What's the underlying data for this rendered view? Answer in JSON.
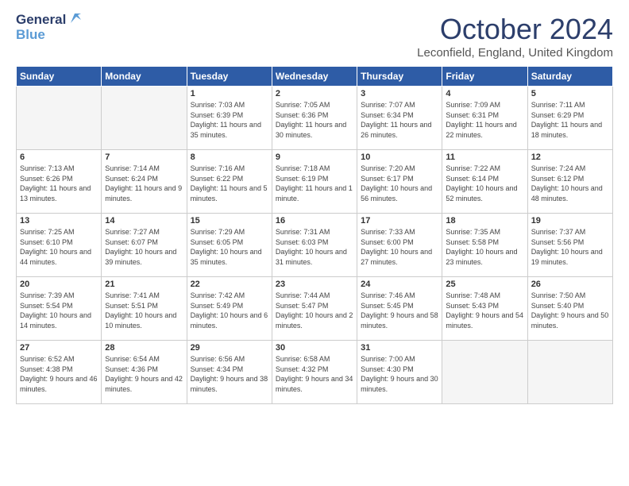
{
  "header": {
    "logo_general": "General",
    "logo_blue": "Blue",
    "month_title": "October 2024",
    "location": "Leconfield, England, United Kingdom"
  },
  "weekdays": [
    "Sunday",
    "Monday",
    "Tuesday",
    "Wednesday",
    "Thursday",
    "Friday",
    "Saturday"
  ],
  "weeks": [
    [
      {
        "day": "",
        "empty": true
      },
      {
        "day": "",
        "empty": true
      },
      {
        "day": "1",
        "sunrise": "Sunrise: 7:03 AM",
        "sunset": "Sunset: 6:39 PM",
        "daylight": "Daylight: 11 hours and 35 minutes."
      },
      {
        "day": "2",
        "sunrise": "Sunrise: 7:05 AM",
        "sunset": "Sunset: 6:36 PM",
        "daylight": "Daylight: 11 hours and 30 minutes."
      },
      {
        "day": "3",
        "sunrise": "Sunrise: 7:07 AM",
        "sunset": "Sunset: 6:34 PM",
        "daylight": "Daylight: 11 hours and 26 minutes."
      },
      {
        "day": "4",
        "sunrise": "Sunrise: 7:09 AM",
        "sunset": "Sunset: 6:31 PM",
        "daylight": "Daylight: 11 hours and 22 minutes."
      },
      {
        "day": "5",
        "sunrise": "Sunrise: 7:11 AM",
        "sunset": "Sunset: 6:29 PM",
        "daylight": "Daylight: 11 hours and 18 minutes."
      }
    ],
    [
      {
        "day": "6",
        "sunrise": "Sunrise: 7:13 AM",
        "sunset": "Sunset: 6:26 PM",
        "daylight": "Daylight: 11 hours and 13 minutes."
      },
      {
        "day": "7",
        "sunrise": "Sunrise: 7:14 AM",
        "sunset": "Sunset: 6:24 PM",
        "daylight": "Daylight: 11 hours and 9 minutes."
      },
      {
        "day": "8",
        "sunrise": "Sunrise: 7:16 AM",
        "sunset": "Sunset: 6:22 PM",
        "daylight": "Daylight: 11 hours and 5 minutes."
      },
      {
        "day": "9",
        "sunrise": "Sunrise: 7:18 AM",
        "sunset": "Sunset: 6:19 PM",
        "daylight": "Daylight: 11 hours and 1 minute."
      },
      {
        "day": "10",
        "sunrise": "Sunrise: 7:20 AM",
        "sunset": "Sunset: 6:17 PM",
        "daylight": "Daylight: 10 hours and 56 minutes."
      },
      {
        "day": "11",
        "sunrise": "Sunrise: 7:22 AM",
        "sunset": "Sunset: 6:14 PM",
        "daylight": "Daylight: 10 hours and 52 minutes."
      },
      {
        "day": "12",
        "sunrise": "Sunrise: 7:24 AM",
        "sunset": "Sunset: 6:12 PM",
        "daylight": "Daylight: 10 hours and 48 minutes."
      }
    ],
    [
      {
        "day": "13",
        "sunrise": "Sunrise: 7:25 AM",
        "sunset": "Sunset: 6:10 PM",
        "daylight": "Daylight: 10 hours and 44 minutes."
      },
      {
        "day": "14",
        "sunrise": "Sunrise: 7:27 AM",
        "sunset": "Sunset: 6:07 PM",
        "daylight": "Daylight: 10 hours and 39 minutes."
      },
      {
        "day": "15",
        "sunrise": "Sunrise: 7:29 AM",
        "sunset": "Sunset: 6:05 PM",
        "daylight": "Daylight: 10 hours and 35 minutes."
      },
      {
        "day": "16",
        "sunrise": "Sunrise: 7:31 AM",
        "sunset": "Sunset: 6:03 PM",
        "daylight": "Daylight: 10 hours and 31 minutes."
      },
      {
        "day": "17",
        "sunrise": "Sunrise: 7:33 AM",
        "sunset": "Sunset: 6:00 PM",
        "daylight": "Daylight: 10 hours and 27 minutes."
      },
      {
        "day": "18",
        "sunrise": "Sunrise: 7:35 AM",
        "sunset": "Sunset: 5:58 PM",
        "daylight": "Daylight: 10 hours and 23 minutes."
      },
      {
        "day": "19",
        "sunrise": "Sunrise: 7:37 AM",
        "sunset": "Sunset: 5:56 PM",
        "daylight": "Daylight: 10 hours and 19 minutes."
      }
    ],
    [
      {
        "day": "20",
        "sunrise": "Sunrise: 7:39 AM",
        "sunset": "Sunset: 5:54 PM",
        "daylight": "Daylight: 10 hours and 14 minutes."
      },
      {
        "day": "21",
        "sunrise": "Sunrise: 7:41 AM",
        "sunset": "Sunset: 5:51 PM",
        "daylight": "Daylight: 10 hours and 10 minutes."
      },
      {
        "day": "22",
        "sunrise": "Sunrise: 7:42 AM",
        "sunset": "Sunset: 5:49 PM",
        "daylight": "Daylight: 10 hours and 6 minutes."
      },
      {
        "day": "23",
        "sunrise": "Sunrise: 7:44 AM",
        "sunset": "Sunset: 5:47 PM",
        "daylight": "Daylight: 10 hours and 2 minutes."
      },
      {
        "day": "24",
        "sunrise": "Sunrise: 7:46 AM",
        "sunset": "Sunset: 5:45 PM",
        "daylight": "Daylight: 9 hours and 58 minutes."
      },
      {
        "day": "25",
        "sunrise": "Sunrise: 7:48 AM",
        "sunset": "Sunset: 5:43 PM",
        "daylight": "Daylight: 9 hours and 54 minutes."
      },
      {
        "day": "26",
        "sunrise": "Sunrise: 7:50 AM",
        "sunset": "Sunset: 5:40 PM",
        "daylight": "Daylight: 9 hours and 50 minutes."
      }
    ],
    [
      {
        "day": "27",
        "sunrise": "Sunrise: 6:52 AM",
        "sunset": "Sunset: 4:38 PM",
        "daylight": "Daylight: 9 hours and 46 minutes."
      },
      {
        "day": "28",
        "sunrise": "Sunrise: 6:54 AM",
        "sunset": "Sunset: 4:36 PM",
        "daylight": "Daylight: 9 hours and 42 minutes."
      },
      {
        "day": "29",
        "sunrise": "Sunrise: 6:56 AM",
        "sunset": "Sunset: 4:34 PM",
        "daylight": "Daylight: 9 hours and 38 minutes."
      },
      {
        "day": "30",
        "sunrise": "Sunrise: 6:58 AM",
        "sunset": "Sunset: 4:32 PM",
        "daylight": "Daylight: 9 hours and 34 minutes."
      },
      {
        "day": "31",
        "sunrise": "Sunrise: 7:00 AM",
        "sunset": "Sunset: 4:30 PM",
        "daylight": "Daylight: 9 hours and 30 minutes."
      },
      {
        "day": "",
        "empty": true
      },
      {
        "day": "",
        "empty": true
      }
    ]
  ]
}
